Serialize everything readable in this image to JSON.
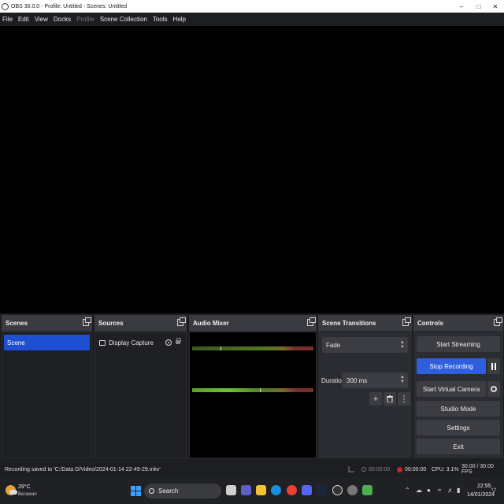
{
  "window": {
    "title": "OBS 30.0.0 - Profile: Untitled - Scenes: Untitled",
    "minimize": "–",
    "maximize": "□",
    "close": "✕"
  },
  "menu": [
    "File",
    "Edit",
    "View",
    "Docks",
    "Profile",
    "Scene Collection",
    "Tools",
    "Help"
  ],
  "menu_disabled": [
    "Profile"
  ],
  "docks": {
    "scenes": {
      "title": "Scenes",
      "items": [
        "Scene"
      ]
    },
    "sources": {
      "title": "Sources",
      "items": [
        "Display Capture"
      ]
    },
    "audio_mixer": {
      "title": "Audio Mixer",
      "meter_count": 2
    },
    "transitions": {
      "title": "Scene Transitions",
      "selected": "Fade",
      "duration_label": "Duration",
      "duration_value": "300 ms",
      "add": "+",
      "remove_icon": "trash-icon",
      "more": "⋮"
    },
    "controls": {
      "title": "Controls",
      "start_streaming": "Start Streaming",
      "stop_recording": "Stop Recording",
      "start_virtual_camera": "Start Virtual Camera",
      "studio_mode": "Studio Mode",
      "settings": "Settings",
      "exit": "Exit"
    }
  },
  "status": {
    "message": "Recording saved to 'C:/Data D/Video/2024-01-14 22-49-29.mkv'",
    "stream_time": "00:00:00",
    "rec_time": "00:00:00",
    "cpu": "CPU: 3.1%",
    "fps": "30.00 / 30.00 FPS"
  },
  "taskbar": {
    "weather_temp": "29°C",
    "weather_condition": "Berawan",
    "search_placeholder": "Search",
    "time": "22:55",
    "date": "14/01/2024"
  },
  "colors": {
    "accent": "#2f5fdf",
    "scene_selected": "#1e4fd1",
    "recording": "#d02020"
  }
}
